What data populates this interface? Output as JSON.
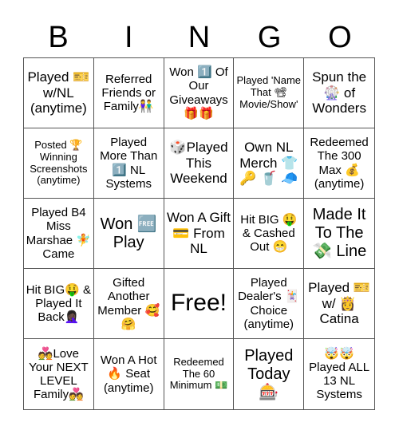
{
  "title_letters": [
    "B",
    "I",
    "N",
    "G",
    "O"
  ],
  "cells": [
    {
      "text": "Played 🎫 w/NL (anytime)",
      "size": "l"
    },
    {
      "text": "Referred Friends or Family👫",
      "size": "m"
    },
    {
      "text": "Won 1️⃣ Of Our Giveaways 🎁🎁",
      "size": "m"
    },
    {
      "text": "Played 'Name That 📽 Movie/Show'",
      "size": "s"
    },
    {
      "text": "Spun the 🎡 of Wonders",
      "size": "l"
    },
    {
      "text": "Posted 🏆 Winning Screenshots (anytime)",
      "size": "s"
    },
    {
      "text": "Played More Than 1️⃣ NL Systems",
      "size": "m"
    },
    {
      "text": "🎲Played This Weekend",
      "size": "l"
    },
    {
      "text": "Own NL Merch 👕 🔑 🥤 🧢",
      "size": "l"
    },
    {
      "text": "Redeemed The 300 Max 💰 (anytime)",
      "size": "m"
    },
    {
      "text": "Played B4 Miss Marshae 🧚 Came",
      "size": "m"
    },
    {
      "text": "Won 🆓 Play",
      "size": "xl"
    },
    {
      "text": "Won A Gift 💳 From NL",
      "size": "l"
    },
    {
      "text": "Hit BIG 🤑 & Cashed Out 😁",
      "size": "m"
    },
    {
      "text": "Made It To The 💸 Line",
      "size": "xl"
    },
    {
      "text": "Hit BIG🤑 & Played It Back🤦🏿‍♀️",
      "size": "m"
    },
    {
      "text": "Gifted Another Member 🥰🤗",
      "size": "m"
    },
    {
      "text": "Free!",
      "size": "free"
    },
    {
      "text": "Played Dealer's 🃏 Choice (anytime)",
      "size": "m"
    },
    {
      "text": "Played 🎫 w/ 👸 Catina",
      "size": "l"
    },
    {
      "text": "💑Love Your NEXT LEVEL Family💑",
      "size": "m"
    },
    {
      "text": "Won A Hot 🔥 Seat (anytime)",
      "size": "m"
    },
    {
      "text": "Redeemed The 60 Minimum 💵",
      "size": "s"
    },
    {
      "text": "Played Today 🎰",
      "size": "xl"
    },
    {
      "text": "🤯🤯 Played ALL 13 NL Systems",
      "size": "m"
    }
  ]
}
